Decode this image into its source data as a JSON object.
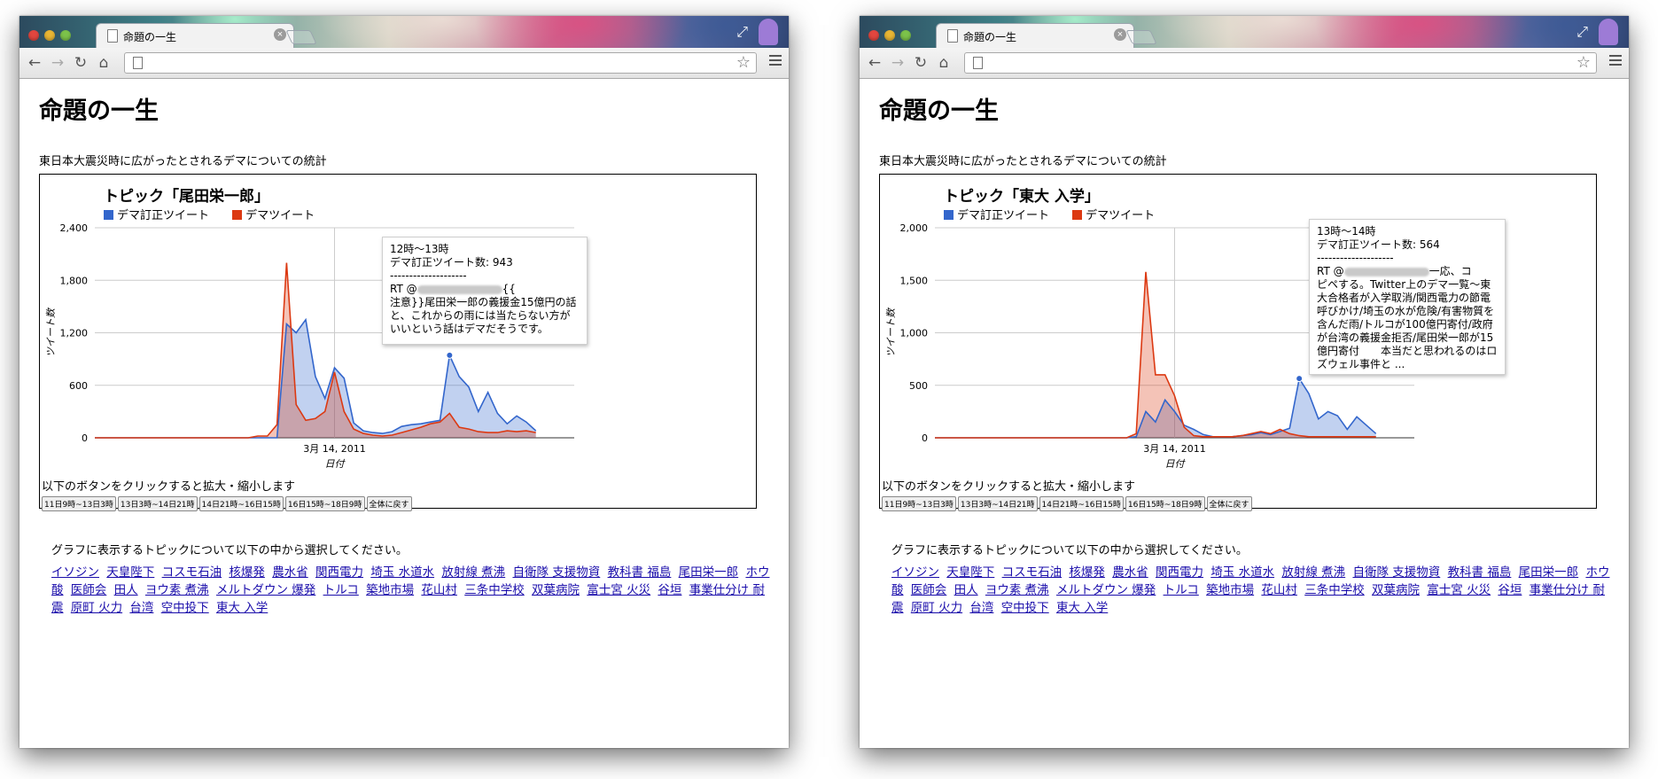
{
  "windows": [
    {
      "tab_title": "命題の一生",
      "page_title": "命題の一生",
      "subtitle": "東日本大震災時に広がったとされるデマについての統計",
      "chart_title": "トピック「尾田栄一郎」",
      "legend": [
        "デマ訂正ツイート",
        "デマツイート"
      ],
      "ylabel": "ツイート数",
      "xlabel": "日付",
      "xtick": "3月 14, 2011",
      "ytick_labels": [
        "0",
        "600",
        "1,200",
        "1,800",
        "2,400"
      ],
      "tooltip": {
        "line1": "12時〜13時",
        "line2": "デマ訂正ツイート数: 943",
        "sep": "--------------------",
        "rt_prefix": "RT @",
        "rt_suffix": "{{",
        "body": "注意}}尾田栄一郎の義援金15億円の話と、これからの雨には当たらない方がいいという話はデマだそうです。"
      },
      "zoom_note": "以下のボタンをクリックすると拡大・縮小します",
      "zoom_buttons": [
        "11日9時~13日3時",
        "13日3時~14日21時",
        "14日21時~16日15時",
        "16日15時~18日9時",
        "全体に戻す"
      ],
      "instruction": "グラフに表示するトピックについて以下の中から選択してください。",
      "topics": [
        "イソジン",
        "天皇陛下",
        "コスモ石油",
        "核爆発",
        "農水省",
        "関西電力",
        "埼玉 水道水",
        "放射線 煮沸",
        "自衛隊 支援物資",
        "教科書 福島",
        "尾田栄一郎",
        "ホウ酸",
        "医師会",
        "田人",
        "ヨウ素 煮沸",
        "メルトダウン 爆発",
        "トルコ",
        "築地市場",
        "花山村",
        "三条中学校",
        "双葉病院",
        "富士宮 火災",
        "谷垣",
        "事業仕分け 耐震",
        "原町 火力",
        "台湾",
        "空中投下",
        "東大 入学"
      ]
    },
    {
      "tab_title": "命題の一生",
      "page_title": "命題の一生",
      "subtitle": "東日本大震災時に広がったとされるデマについての統計",
      "chart_title": "トピック「東大 入学」",
      "legend": [
        "デマ訂正ツイート",
        "デマツイート"
      ],
      "ylabel": "ツイート数",
      "xlabel": "日付",
      "xtick": "3月 14, 2011",
      "ytick_labels": [
        "0",
        "500",
        "1,000",
        "1,500",
        "2,000"
      ],
      "tooltip": {
        "line1": "13時〜14時",
        "line2": "デマ訂正ツイート数: 564",
        "sep": "--------------------",
        "rt_prefix": "RT @",
        "rt_suffix": "一応、コ",
        "body": "ピペする。Twitter上のデマ一覧〜東大合格者が入学取消/関西電力の節電呼びかけ/埼玉の水が危険/有害物質を含んだ雨/トルコが100億円寄付/政府が台湾の義援金拒否/尾田栄一郎が15億円寄付　　本当だと思われるのはロズウェル事件と ..."
      },
      "zoom_note": "以下のボタンをクリックすると拡大・縮小します",
      "zoom_buttons": [
        "11日9時~13日3時",
        "13日3時~14日21時",
        "14日21時~16日15時",
        "16日15時~18日9時",
        "全体に戻す"
      ],
      "instruction": "グラフに表示するトピックについて以下の中から選択してください。",
      "topics": [
        "イソジン",
        "天皇陛下",
        "コスモ石油",
        "核爆発",
        "農水省",
        "関西電力",
        "埼玉 水道水",
        "放射線 煮沸",
        "自衛隊 支援物資",
        "教科書 福島",
        "尾田栄一郎",
        "ホウ酸",
        "医師会",
        "田人",
        "ヨウ素 煮沸",
        "メルトダウン 爆発",
        "トルコ",
        "築地市場",
        "花山村",
        "三条中学校",
        "双葉病院",
        "富士宮 火災",
        "谷垣",
        "事業仕分け 耐震",
        "原町 火力",
        "台湾",
        "空中投下",
        "東大 入学"
      ]
    }
  ],
  "colors": {
    "correction": "#3366cc",
    "rumor": "#dc3912",
    "link": "#1a0dab"
  },
  "chart_data": [
    {
      "type": "area",
      "title": "トピック「尾田栄一郎」",
      "xlabel": "日付",
      "ylabel": "ツイート数",
      "ylim": [
        0,
        2400
      ],
      "x_index_range": [
        0,
        50
      ],
      "series": [
        {
          "name": "デマ訂正ツイート",
          "values": [
            0,
            0,
            0,
            0,
            0,
            0,
            0,
            0,
            0,
            0,
            0,
            0,
            0,
            0,
            0,
            0,
            0,
            0,
            0,
            0,
            1300,
            1200,
            1350,
            700,
            450,
            800,
            680,
            170,
            80,
            60,
            50,
            70,
            130,
            150,
            160,
            180,
            200,
            943,
            700,
            580,
            300,
            520,
            280,
            160,
            250,
            180,
            80
          ]
        },
        {
          "name": "デマツイート",
          "values": [
            0,
            0,
            0,
            0,
            0,
            0,
            0,
            0,
            0,
            0,
            0,
            0,
            0,
            0,
            0,
            0,
            0,
            20,
            20,
            150,
            2000,
            380,
            200,
            220,
            300,
            750,
            300,
            100,
            50,
            30,
            20,
            30,
            60,
            90,
            120,
            160,
            180,
            280,
            120,
            100,
            70,
            60,
            60,
            80,
            70,
            80,
            60
          ]
        }
      ],
      "annotations": [
        "3月 14, 2011"
      ]
    },
    {
      "type": "area",
      "title": "トピック「東大 入学」",
      "xlabel": "日付",
      "ylabel": "ツイート数",
      "ylim": [
        0,
        2000
      ],
      "x_index_range": [
        0,
        50
      ],
      "series": [
        {
          "name": "デマ訂正ツイート",
          "values": [
            0,
            0,
            0,
            0,
            0,
            0,
            0,
            0,
            0,
            0,
            0,
            0,
            0,
            0,
            0,
            0,
            0,
            0,
            0,
            0,
            0,
            10,
            250,
            150,
            360,
            250,
            120,
            80,
            30,
            10,
            10,
            10,
            20,
            30,
            50,
            30,
            60,
            90,
            564,
            420,
            180,
            250,
            210,
            80,
            200,
            120,
            40
          ]
        },
        {
          "name": "デマツイート",
          "values": [
            0,
            0,
            0,
            0,
            0,
            0,
            0,
            0,
            0,
            0,
            0,
            0,
            0,
            0,
            0,
            0,
            0,
            0,
            0,
            0,
            0,
            40,
            1580,
            600,
            600,
            400,
            100,
            20,
            10,
            10,
            10,
            10,
            20,
            40,
            60,
            40,
            80,
            40,
            20,
            10,
            10,
            10,
            10,
            10,
            10,
            10,
            10
          ]
        }
      ],
      "annotations": [
        "3月 14, 2011"
      ]
    }
  ]
}
